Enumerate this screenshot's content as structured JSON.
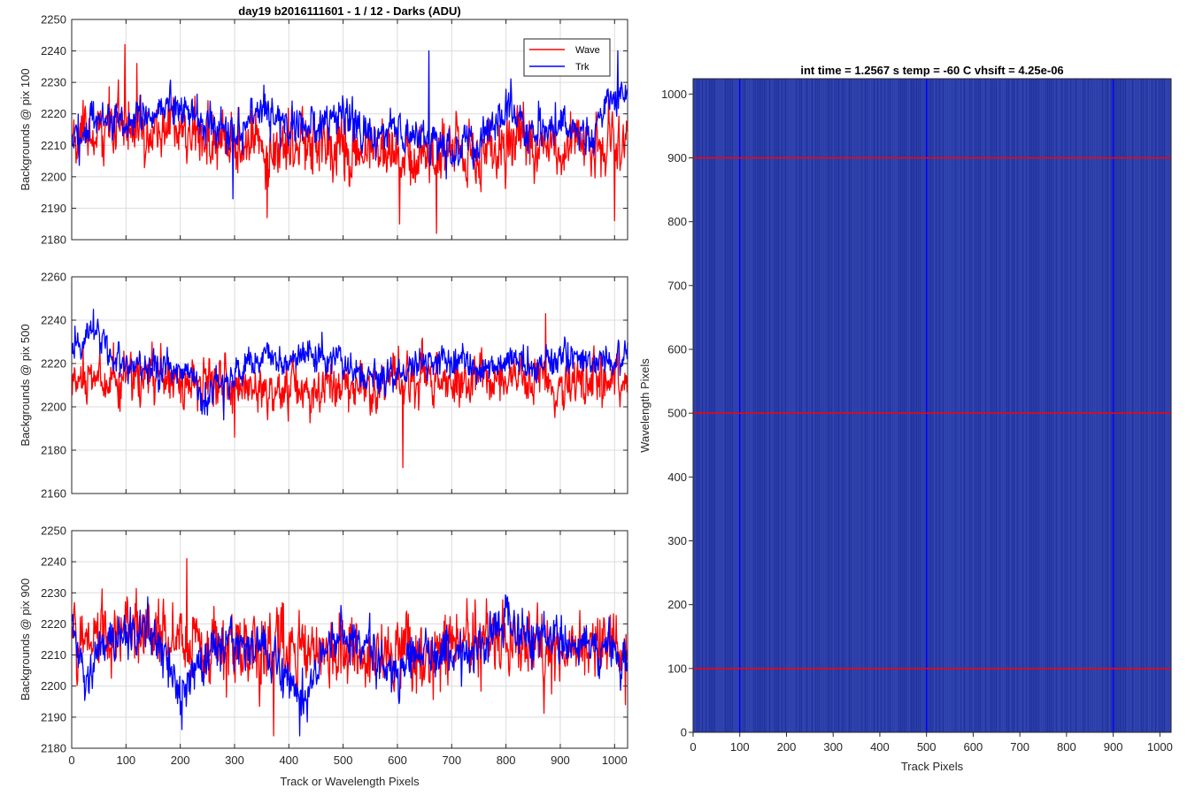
{
  "chart_data": [
    {
      "type": "line",
      "title": "day19 b2016111601 - 1 / 12 - Darks (ADU)",
      "xlabel": "",
      "ylabel": "Backgrounds @ pix 100",
      "xlim": [
        0,
        1024
      ],
      "ylim": [
        2180,
        2250
      ],
      "xticks": [
        0,
        100,
        200,
        300,
        400,
        500,
        600,
        700,
        800,
        900,
        1000
      ],
      "yticks": [
        2180,
        2190,
        2200,
        2210,
        2220,
        2230,
        2240,
        2250
      ],
      "grid": true,
      "legend": {
        "placement": "top-right",
        "entries": [
          "Wave",
          "Trk"
        ]
      },
      "series": [
        {
          "name": "Wave",
          "color": "#ff0000",
          "mean": 2212,
          "noise": 8,
          "anchors": [
            [
              0,
              2212
            ],
            [
              100,
              2217
            ],
            [
              200,
              2215
            ],
            [
              300,
              2211
            ],
            [
              400,
              2208
            ],
            [
              500,
              2210
            ],
            [
              600,
              2207
            ],
            [
              700,
              2208
            ],
            [
              800,
              2209
            ],
            [
              900,
              2211
            ],
            [
              1024,
              2212
            ]
          ],
          "extremes": [
            [
              98,
              2242
            ],
            [
              120,
              2236
            ],
            [
              360,
              2187
            ],
            [
              604,
              2185
            ],
            [
              672,
              2182
            ],
            [
              1000,
              2186
            ]
          ]
        },
        {
          "name": "Trk",
          "color": "#0000ff",
          "mean": 2218,
          "noise": 5,
          "anchors": [
            [
              0,
              2212
            ],
            [
              50,
              2218
            ],
            [
              100,
              2218
            ],
            [
              200,
              2222
            ],
            [
              300,
              2213
            ],
            [
              350,
              2222
            ],
            [
              400,
              2218
            ],
            [
              450,
              2214
            ],
            [
              500,
              2222
            ],
            [
              550,
              2211
            ],
            [
              600,
              2214
            ],
            [
              650,
              2213
            ],
            [
              700,
              2207
            ],
            [
              750,
              2212
            ],
            [
              800,
              2222
            ],
            [
              850,
              2214
            ],
            [
              900,
              2217
            ],
            [
              950,
              2212
            ],
            [
              1000,
              2226
            ],
            [
              1024,
              2228
            ]
          ],
          "extremes": [
            [
              297,
              2193
            ],
            [
              658,
              2240
            ],
            [
              1006,
              2240
            ]
          ]
        }
      ]
    },
    {
      "type": "line",
      "title": "",
      "xlabel": "",
      "ylabel": "Backgrounds @ pix 500",
      "xlim": [
        0,
        1024
      ],
      "ylim": [
        2160,
        2260
      ],
      "xticks": [
        0,
        100,
        200,
        300,
        400,
        500,
        600,
        700,
        800,
        900,
        1000
      ],
      "yticks": [
        2160,
        2180,
        2200,
        2220,
        2240,
        2260
      ],
      "grid": true,
      "series": [
        {
          "name": "Wave",
          "color": "#ff0000",
          "mean": 2212,
          "noise": 9,
          "anchors": [
            [
              0,
              2210
            ],
            [
              100,
              2214
            ],
            [
              200,
              2212
            ],
            [
              300,
              2210
            ],
            [
              400,
              2210
            ],
            [
              500,
              2210
            ],
            [
              600,
              2212
            ],
            [
              700,
              2210
            ],
            [
              800,
              2212
            ],
            [
              900,
              2210
            ],
            [
              1024,
              2212
            ]
          ],
          "extremes": [
            [
              610,
              2172
            ],
            [
              873,
              2243
            ],
            [
              300,
              2186
            ]
          ]
        },
        {
          "name": "Trk",
          "color": "#0000ff",
          "mean": 2220,
          "noise": 6,
          "anchors": [
            [
              0,
              2228
            ],
            [
              40,
              2236
            ],
            [
              80,
              2222
            ],
            [
              150,
              2218
            ],
            [
              200,
              2218
            ],
            [
              250,
              2204
            ],
            [
              300,
              2214
            ],
            [
              350,
              2224
            ],
            [
              400,
              2222
            ],
            [
              450,
              2224
            ],
            [
              500,
              2221
            ],
            [
              550,
              2212
            ],
            [
              600,
              2215
            ],
            [
              650,
              2220
            ],
            [
              700,
              2222
            ],
            [
              750,
              2218
            ],
            [
              800,
              2222
            ],
            [
              850,
              2218
            ],
            [
              900,
              2224
            ],
            [
              950,
              2222
            ],
            [
              1024,
              2222
            ]
          ],
          "extremes": [
            [
              40,
              2245
            ],
            [
              280,
              2194
            ]
          ]
        }
      ]
    },
    {
      "type": "line",
      "title": "",
      "xlabel": "Track or Wavelength Pixels",
      "ylabel": "Backgrounds @ pix 900",
      "xlim": [
        0,
        1024
      ],
      "ylim": [
        2180,
        2250
      ],
      "xticks": [
        0,
        100,
        200,
        300,
        400,
        500,
        600,
        700,
        800,
        900,
        1000
      ],
      "yticks": [
        2180,
        2190,
        2200,
        2210,
        2220,
        2230,
        2240,
        2250
      ],
      "grid": true,
      "series": [
        {
          "name": "Wave",
          "color": "#ff0000",
          "mean": 2213,
          "noise": 9,
          "anchors": [
            [
              0,
              2213
            ],
            [
              100,
              2218
            ],
            [
              200,
              2214
            ],
            [
              300,
              2210
            ],
            [
              400,
              2212
            ],
            [
              500,
              2212
            ],
            [
              600,
              2210
            ],
            [
              700,
              2212
            ],
            [
              800,
              2212
            ],
            [
              900,
              2212
            ],
            [
              1024,
              2212
            ]
          ],
          "extremes": [
            [
              212,
              2241
            ],
            [
              372,
              2184
            ],
            [
              1020,
              2194
            ]
          ]
        },
        {
          "name": "Trk",
          "color": "#0000ff",
          "mean": 2214,
          "noise": 6,
          "anchors": [
            [
              0,
              2218
            ],
            [
              25,
              2200
            ],
            [
              50,
              2212
            ],
            [
              100,
              2218
            ],
            [
              150,
              2216
            ],
            [
              200,
              2196
            ],
            [
              250,
              2210
            ],
            [
              300,
              2214
            ],
            [
              350,
              2212
            ],
            [
              420,
              2196
            ],
            [
              480,
              2216
            ],
            [
              550,
              2212
            ],
            [
              600,
              2204
            ],
            [
              650,
              2212
            ],
            [
              700,
              2208
            ],
            [
              750,
              2212
            ],
            [
              800,
              2222
            ],
            [
              850,
              2214
            ],
            [
              900,
              2216
            ],
            [
              950,
              2214
            ],
            [
              1024,
              2208
            ]
          ],
          "extremes": [
            [
              203,
              2186
            ],
            [
              420,
              2184
            ]
          ]
        }
      ]
    },
    {
      "type": "heatmap",
      "title": "int time = 1.2567 s    temp = -60 C    vhsift = 4.25e-06",
      "xlabel": "Track Pixels",
      "ylabel": "Wavelength Pixels",
      "xlim": [
        0,
        1024
      ],
      "ylim": [
        0,
        1024
      ],
      "xticks": [
        0,
        100,
        200,
        300,
        400,
        500,
        600,
        700,
        800,
        900,
        1000
      ],
      "yticks": [
        0,
        100,
        200,
        300,
        400,
        500,
        600,
        700,
        800,
        900,
        1000
      ],
      "base_color": "#2b3ea8",
      "marker_lines": {
        "vertical_x": [
          100,
          500,
          900
        ],
        "vertical_color": "#0000ff",
        "horizontal_y": [
          100,
          500,
          900
        ],
        "horizontal_color": "#ff0000"
      }
    }
  ]
}
